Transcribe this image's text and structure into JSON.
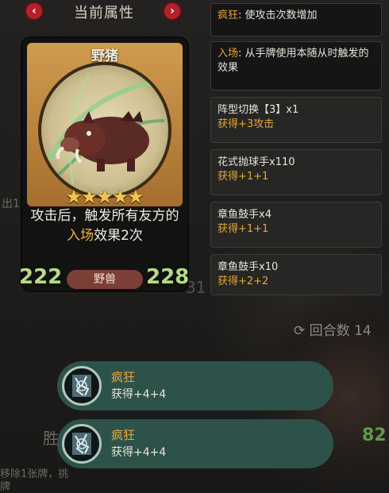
{
  "header": {
    "title": "当前属性",
    "prev": "‹",
    "next": "›"
  },
  "card": {
    "name": "野猪",
    "stars": 5,
    "desc_before": "攻击后，触发所有友方的",
    "desc_keyword": "入场",
    "desc_after": "效果2次",
    "attack": "222",
    "health": "228",
    "tag": "野兽"
  },
  "keywords": [
    {
      "name": "疯狂",
      "text": ": 使攻击次数增加"
    },
    {
      "name": "入场",
      "text": ": 从手牌使用本随从时触发的效果"
    }
  ],
  "bonuses": [
    {
      "title": "阵型切换【3】x1",
      "gain": "获得+3攻击"
    },
    {
      "title": "花式抛球手x110",
      "gain": "获得+1+1"
    },
    {
      "title": "章鱼鼓手x4",
      "gain": "获得+1+1"
    },
    {
      "title": "章鱼鼓手x10",
      "gain": "获得+2+2"
    }
  ],
  "background": {
    "round_label": "回合数",
    "round_value": "14",
    "remove_text": "移除1张牌，挑",
    "remove_text2": "牌",
    "side_text": "出1",
    "win_text": "胜",
    "enemy_stat": "82",
    "hidden_num": "31"
  },
  "buffs": [
    {
      "name": "疯狂",
      "value": "获得+4+4"
    },
    {
      "name": "疯狂",
      "value": "获得+4+4"
    }
  ]
}
